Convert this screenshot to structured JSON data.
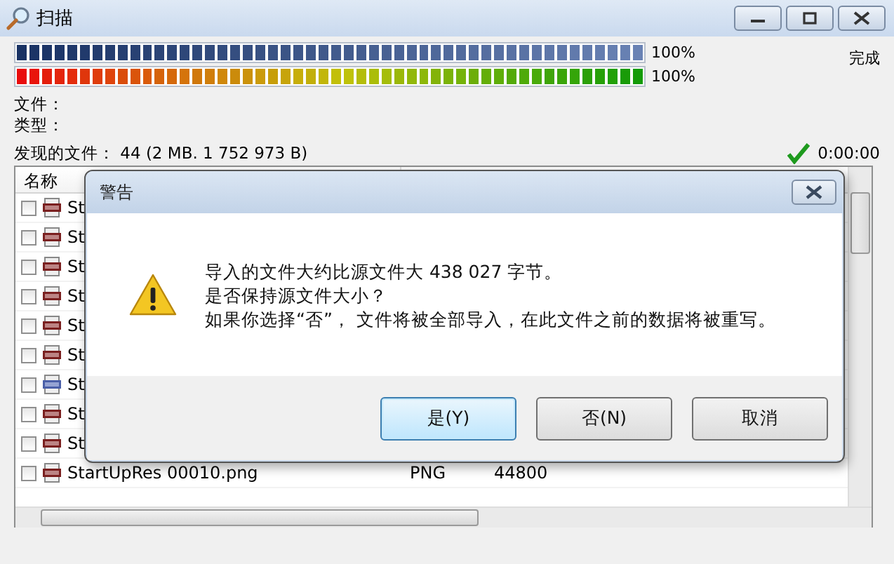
{
  "window": {
    "title": "扫描"
  },
  "progress": [
    {
      "kind": "blue",
      "level": 1,
      "reading": "100%"
    },
    {
      "kind": "spectrum",
      "level": 1,
      "reading": "100%"
    }
  ],
  "status": "完成",
  "fields": [
    {
      "label": "文件："
    },
    {
      "label": "类型："
    }
  ],
  "found": "发现的文件： 44 (2 MB. 1 752 973 B)",
  "elapsed": "0:00:00",
  "table": {
    "columns": [
      "名称"
    ],
    "rows": [
      {
        "checked": false,
        "kind": "png",
        "name": "St"
      },
      {
        "checked": false,
        "kind": "png",
        "name": "St"
      },
      {
        "checked": false,
        "kind": "png",
        "name": "St"
      },
      {
        "checked": false,
        "kind": "png",
        "name": "St"
      },
      {
        "checked": false,
        "kind": "png",
        "name": "St"
      },
      {
        "checked": false,
        "kind": "png",
        "name": "St"
      },
      {
        "checked": false,
        "kind": "bmp",
        "name": "St"
      },
      {
        "checked": false,
        "kind": "png",
        "name": "St"
      },
      {
        "checked": false,
        "kind": "png",
        "name": "St"
      },
      {
        "checked": false,
        "kind": "png",
        "name": "StartUpRes 00010.png",
        "type": "PNG",
        "column_3": "44800"
      }
    ]
  },
  "dialog": {
    "title": "警告",
    "message": [
      "导入的文件大约比源文件大 438 027 字节。",
      "是否保持源文件大小？",
      "如果你选择“否”， 文件将被全部导入，在此文件之前的数据将被重写。"
    ],
    "buttons": [
      {
        "label": "是(Y)",
        "default": true
      },
      {
        "label": "否(N)",
        "default": false
      },
      {
        "label": "取消",
        "default": false
      }
    ]
  }
}
